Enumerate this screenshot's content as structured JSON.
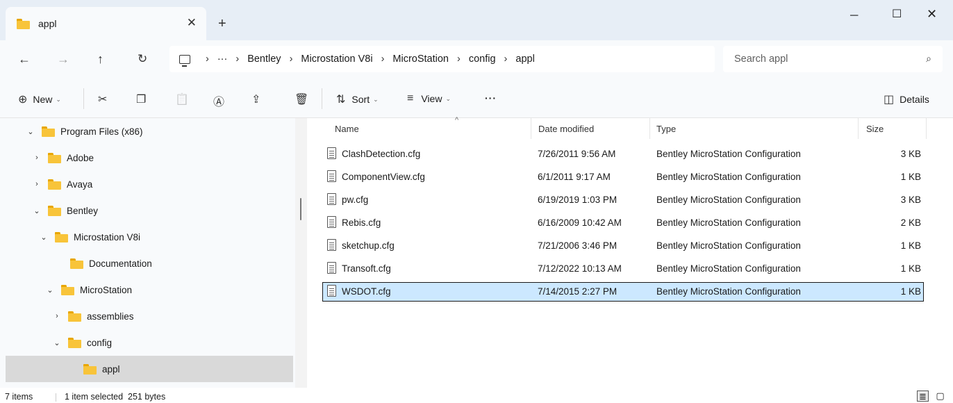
{
  "tab": {
    "title": "appl",
    "close": "✕",
    "new": "+"
  },
  "window_controls": {
    "minimize": "─",
    "maximize": "☐",
    "close": "✕"
  },
  "nav": {
    "back": "←",
    "forward": "→",
    "up": "↑",
    "refresh": "↻"
  },
  "address": {
    "overflow": "···",
    "separator": "›",
    "crumbs": [
      "Bentley",
      "Microstation V8i",
      "MicroStation",
      "config",
      "appl"
    ]
  },
  "search": {
    "placeholder": "Search appl",
    "icon": "⌕"
  },
  "commands": {
    "new_label": "New",
    "sort_label": "Sort",
    "view_label": "View",
    "more": "···",
    "details_label": "Details",
    "caret": "⌄",
    "icons": {
      "new": "⊕",
      "cut": "✂",
      "copy": "❐",
      "paste": "📋",
      "rename": "Ⓐ",
      "share": "⇪",
      "delete": "🗑",
      "sort": "⇅",
      "view": "≡",
      "details": "◫"
    }
  },
  "tree": [
    {
      "label": "Program Files (x86)",
      "chevron": "⌄",
      "depth": 0
    },
    {
      "label": "Adobe",
      "chevron": "›",
      "depth": 1
    },
    {
      "label": "Avaya",
      "chevron": "›",
      "depth": 1
    },
    {
      "label": "Bentley",
      "chevron": "⌄",
      "depth": 1
    },
    {
      "label": "Microstation V8i",
      "chevron": "⌄",
      "depth": 2
    },
    {
      "label": "Documentation",
      "chevron": "",
      "depth": 3
    },
    {
      "label": "MicroStation",
      "chevron": "⌄",
      "depth": 3
    },
    {
      "label": "assemblies",
      "chevron": "›",
      "depth": 4
    },
    {
      "label": "config",
      "chevron": "⌄",
      "depth": 4
    },
    {
      "label": "appl",
      "chevron": "",
      "depth": 5,
      "selected": true
    }
  ],
  "columns": {
    "name": "Name",
    "date": "Date modified",
    "type": "Type",
    "size": "Size",
    "sort_indicator": "^"
  },
  "files": [
    {
      "name": "ClashDetection.cfg",
      "date": "7/26/2011 9:56 AM",
      "type": "Bentley MicroStation Configuration",
      "size": "3 KB"
    },
    {
      "name": "ComponentView.cfg",
      "date": "6/1/2011 9:17 AM",
      "type": "Bentley MicroStation Configuration",
      "size": "1 KB"
    },
    {
      "name": "pw.cfg",
      "date": "6/19/2019 1:03 PM",
      "type": "Bentley MicroStation Configuration",
      "size": "3 KB"
    },
    {
      "name": "Rebis.cfg",
      "date": "6/16/2009 10:42 AM",
      "type": "Bentley MicroStation Configuration",
      "size": "2 KB"
    },
    {
      "name": "sketchup.cfg",
      "date": "7/21/2006 3:46 PM",
      "type": "Bentley MicroStation Configuration",
      "size": "1 KB"
    },
    {
      "name": "Transoft.cfg",
      "date": "7/12/2022 10:13 AM",
      "type": "Bentley MicroStation Configuration",
      "size": "1 KB"
    },
    {
      "name": "WSDOT.cfg",
      "date": "7/14/2015 2:27 PM",
      "type": "Bentley MicroStation Configuration",
      "size": "1 KB",
      "selected": true
    }
  ],
  "status": {
    "items": "7 items",
    "selection": "1 item selected  251 bytes",
    "view_details": "≣",
    "view_tiles": "▢"
  },
  "colors": {
    "selection": "#cce8ff",
    "folder": "#f8c43a",
    "tabbar": "#e7eef6",
    "chrome": "#f8fafc"
  }
}
